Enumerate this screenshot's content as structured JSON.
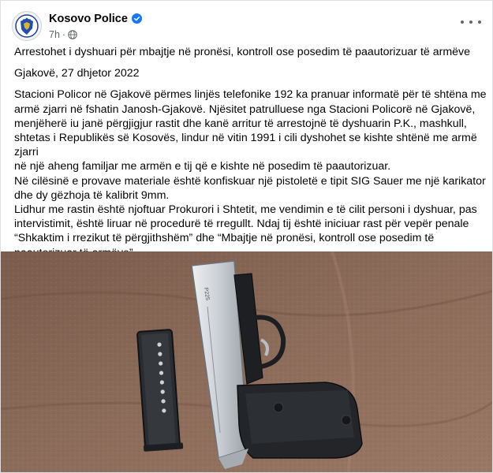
{
  "post": {
    "author": "Kosovo Police",
    "verified_icon": "verified-badge-icon",
    "time": "7h",
    "separator": "·",
    "audience_icon": "globe-icon",
    "more_icon": "more-options-icon",
    "headline": "Arrestohet i dyshuari për mbajtje në pronësi, kontroll ose posedim të paautorizuar të armëve",
    "dateline": "Gjakovë, 27 dhjetor 2022",
    "lines": [
      "Stacioni Policor në Gjakovë përmes linjës telefonike 192 ka pranuar informatë për të shtëna me",
      "armë zjarri në fshatin Janosh-Gjakovë. Njësitet patrulluese nga Stacioni Policorë në Gjakovë,",
      "menjëherë iu janë përgjigjur rastit dhe kanë arritur të arrestojnë të dyshuarin P.K., mashkull,",
      "shtetas i Republikës së Kosovës, lindur në vitin 1991 i cili dyshohet se kishte shtënë me armë zjarri",
      "në një aheng familjar me armën e tij që e kishte në posedim të paautorizuar.",
      "Në cilësinë e provave materiale është konfiskuar një pistoletë e tipit  SIG Sauer me një karikator",
      "dhe dy gëzhoja të kalibrit 9mm.",
      "Lidhur me rastin është njoftuar Prokurori i Shtetit, me vendimin e të cilit personi i dyshuar, pas",
      "intervistimit, është liruar në procedurë të rregullt. Ndaj tij është iniciuar rast për vepër penale",
      "“Shkaktim i rrezikut të përgjithshëm” dhe “Mbajtje në pronësi, kontroll ose posedim të",
      "paautorizuar të armëve”."
    ],
    "photo": {
      "pistol_marking": "P225"
    },
    "colors": {
      "accent_blue": "#1877f2",
      "secondary_text": "#65676b",
      "carpet": "#8a6a58"
    }
  }
}
